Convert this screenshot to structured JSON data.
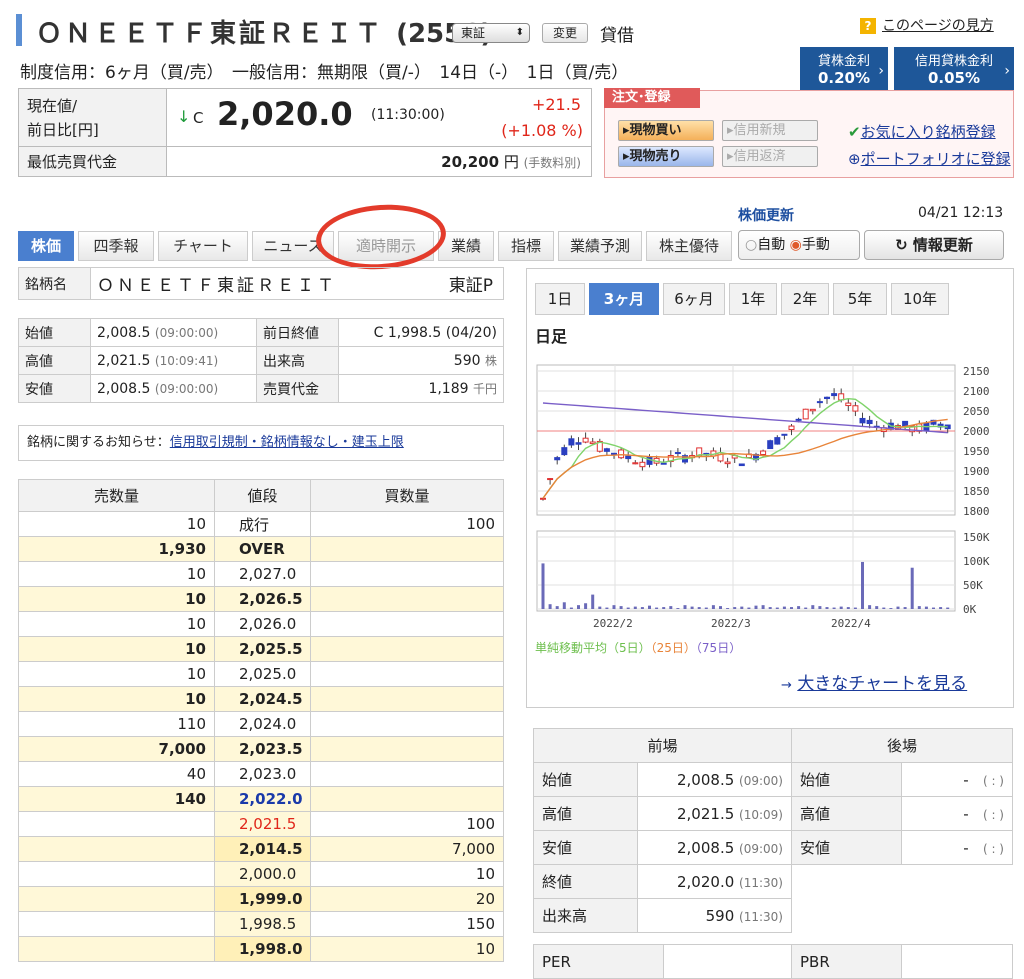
{
  "header": {
    "title": "ＯＮＥＥＴＦ東証ＲＥＩＴ",
    "code": "(2556)",
    "market_select": "東証",
    "change_btn": "変更",
    "kashi": "貸借",
    "help": "このページの見方",
    "credit": "制度信用：6ヶ月（買/売）　一般信用：無期限（買/-）　14日（-）　1日（買/売）",
    "lend_rate_label": "貸株金利",
    "lend_rate": "0.20%",
    "credit_lend_label": "信用貸株金利",
    "credit_lend": "0.05%"
  },
  "price": {
    "label1": "現在値/",
    "label2": "前日比[円]",
    "arrow": "↓",
    "c": "C",
    "value": "2,020.0",
    "time": "(11:30:00)",
    "change": "+21.5",
    "change_pct": "(+1.08 %)",
    "min_label": "最低売買代金",
    "min_value": "20,200",
    "min_unit": "円",
    "fee": "(手数料別)"
  },
  "order": {
    "tag": "注文･登録",
    "buy": "▸現物買い",
    "credit_new": "▸信用新規",
    "sell": "▸現物売り",
    "credit_close": "▸信用返済",
    "fav": "お気に入り銘柄登録",
    "portfolio": "ポートフォリオに登録"
  },
  "tabs": [
    "株価",
    "四季報",
    "チャート",
    "ニュース",
    "適時開示",
    "業績",
    "指標",
    "業績予測",
    "株主優待"
  ],
  "update": {
    "label": "株価更新",
    "time": "04/21 12:13",
    "auto": "自動",
    "manual": "手動",
    "refresh": "情報更新"
  },
  "name_row": {
    "label": "銘柄名",
    "name": "ＯＮＥＥＴＦ東証ＲＥＩＴ",
    "market": "東証P"
  },
  "quote": [
    {
      "l": "始値",
      "v": "2,008.5",
      "t": "(09:00:00)",
      "l2": "前日終値",
      "v2": "C 1,998.5 (04/20)",
      "u2": ""
    },
    {
      "l": "高値",
      "v": "2,021.5",
      "t": "(10:09:41)",
      "l2": "出来高",
      "v2": "590",
      "u2": "株"
    },
    {
      "l": "安値",
      "v": "2,008.5",
      "t": "(09:00:00)",
      "l2": "売買代金",
      "v2": "1,189",
      "u2": "千円"
    }
  ],
  "notice": {
    "label": "銘柄に関するお知らせ：",
    "link": "信用取引規制・銘柄情報なし・建玉上限"
  },
  "orderbook": {
    "headers": [
      "売数量",
      "値段",
      "買数量"
    ],
    "rows": [
      [
        "10",
        "成行",
        "100",
        "n"
      ],
      [
        "1,930",
        "OVER",
        "",
        "y"
      ],
      [
        "10",
        "2,027.0",
        "",
        "n"
      ],
      [
        "10",
        "2,026.5",
        "",
        "y"
      ],
      [
        "10",
        "2,026.0",
        "",
        "n"
      ],
      [
        "10",
        "2,025.5",
        "",
        "y"
      ],
      [
        "10",
        "2,025.0",
        "",
        "n"
      ],
      [
        "10",
        "2,024.5",
        "",
        "y"
      ],
      [
        "110",
        "2,024.0",
        "",
        "n"
      ],
      [
        "7,000",
        "2,023.5",
        "",
        "y"
      ],
      [
        "40",
        "2,023.0",
        "",
        "n"
      ],
      [
        "140",
        "2,022.0",
        "",
        "y"
      ],
      [
        "",
        "2,021.5",
        "100",
        "n"
      ],
      [
        "",
        "2,014.5",
        "7,000",
        "y"
      ],
      [
        "",
        "2,000.0",
        "10",
        "n"
      ],
      [
        "",
        "1,999.0",
        "20",
        "y"
      ],
      [
        "",
        "1,998.5",
        "150",
        "n"
      ],
      [
        "",
        "1,998.0",
        "10",
        "y"
      ]
    ]
  },
  "chart": {
    "periods": [
      "1日",
      "3ヶ月",
      "6ヶ月",
      "1年",
      "2年",
      "5年",
      "10年"
    ],
    "active": "3ヶ月",
    "label": "日足",
    "legend_a": "単純移動平均（5日）",
    "legend_b": "（25日）",
    "legend_c": "（75日）",
    "big_link": "大きなチャートを見る"
  },
  "chart_data": {
    "type": "candlestick",
    "y_ticks": [
      "2150",
      "2100",
      "2050",
      "2000",
      "1950",
      "1900",
      "1850",
      "1800"
    ],
    "vol_ticks": [
      "150K",
      "100K",
      "50K",
      "0K"
    ],
    "x_labels": [
      "2022/2",
      "2022/3",
      "2022/4"
    ],
    "series": [
      {
        "name": "5日",
        "color": "#7fd36a"
      },
      {
        "name": "25日",
        "color": "#e8843a"
      },
      {
        "name": "75日",
        "color": "#7a5fc8"
      }
    ]
  },
  "session": {
    "h1": "前場",
    "h2": "後場",
    "rows": [
      {
        "l": "始値",
        "v": "2,008.5",
        "t": "(09:00)",
        "l2": "始値",
        "v2": "-",
        "t2": "( : )"
      },
      {
        "l": "高値",
        "v": "2,021.5",
        "t": "(10:09)",
        "l2": "高値",
        "v2": "-",
        "t2": "( : )"
      },
      {
        "l": "安値",
        "v": "2,008.5",
        "t": "(09:00)",
        "l2": "安値",
        "v2": "-",
        "t2": "( : )"
      },
      {
        "l": "終値",
        "v": "2,020.0",
        "t": "(11:30)",
        "l2": "",
        "v2": "",
        "t2": ""
      },
      {
        "l": "出来高",
        "v": "590",
        "t": "(11:30)",
        "l2": "",
        "v2": "",
        "t2": ""
      }
    ]
  },
  "ratios": {
    "per": "PER",
    "pbr": "PBR"
  }
}
